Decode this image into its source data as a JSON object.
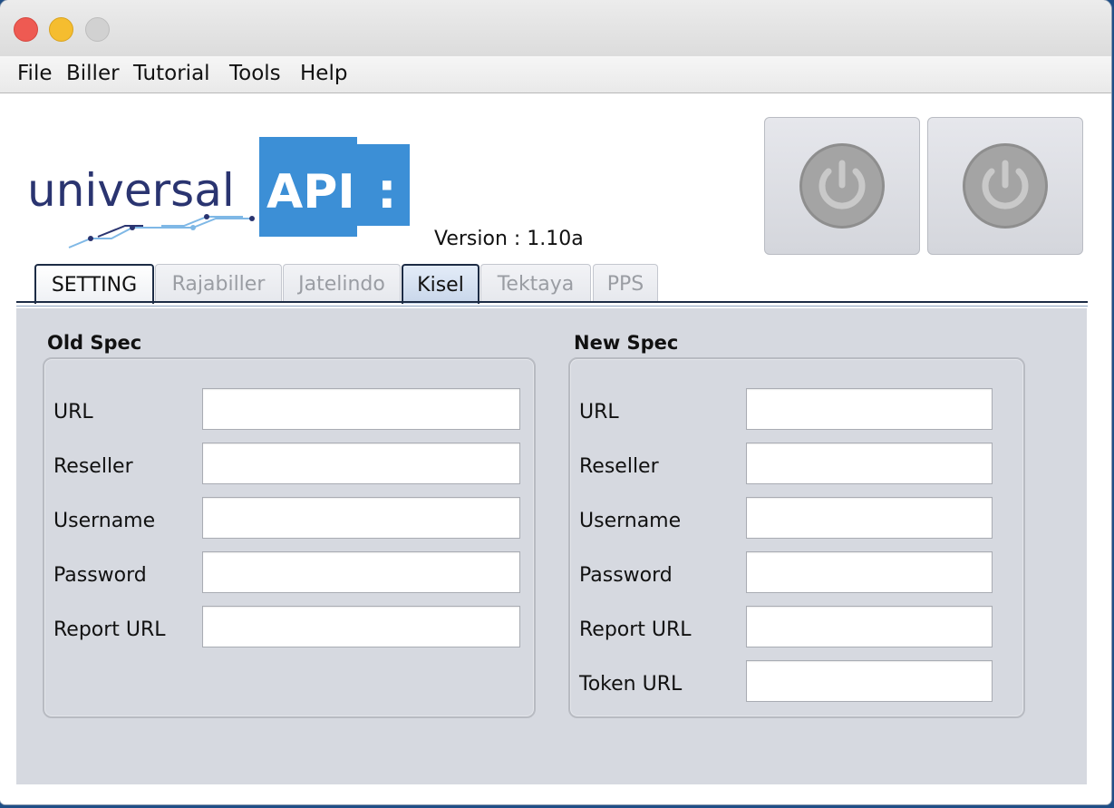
{
  "menu": [
    "File",
    "Biller",
    "Tutorial",
    "Tools",
    "Help"
  ],
  "logo": {
    "text_left": "universal",
    "text_right": "API",
    "colon": ":"
  },
  "version": "Version : 1.10a",
  "tabs": [
    "SETTING",
    "Rajabiller",
    "Jatelindo",
    "Kisel",
    "Tektaya",
    "PPS"
  ],
  "selected_tab": "Kisel",
  "old_spec": {
    "title": "Old Spec",
    "fields": [
      {
        "label": "URL",
        "value": ""
      },
      {
        "label": "Reseller",
        "value": ""
      },
      {
        "label": "Username",
        "value": ""
      },
      {
        "label": "Password",
        "value": ""
      },
      {
        "label": "Report URL",
        "value": ""
      }
    ]
  },
  "new_spec": {
    "title": "New Spec",
    "fields": [
      {
        "label": "URL",
        "value": ""
      },
      {
        "label": "Reseller",
        "value": ""
      },
      {
        "label": "Username",
        "value": ""
      },
      {
        "label": "Password",
        "value": ""
      },
      {
        "label": "Report URL",
        "value": ""
      },
      {
        "label": "Token URL",
        "value": ""
      }
    ]
  },
  "icons": [
    "power-icon",
    "power-icon"
  ],
  "colors": {
    "logo_blue": "#3c8fd6",
    "logo_navy": "#2a3470",
    "panel": "#d6d9e0"
  }
}
